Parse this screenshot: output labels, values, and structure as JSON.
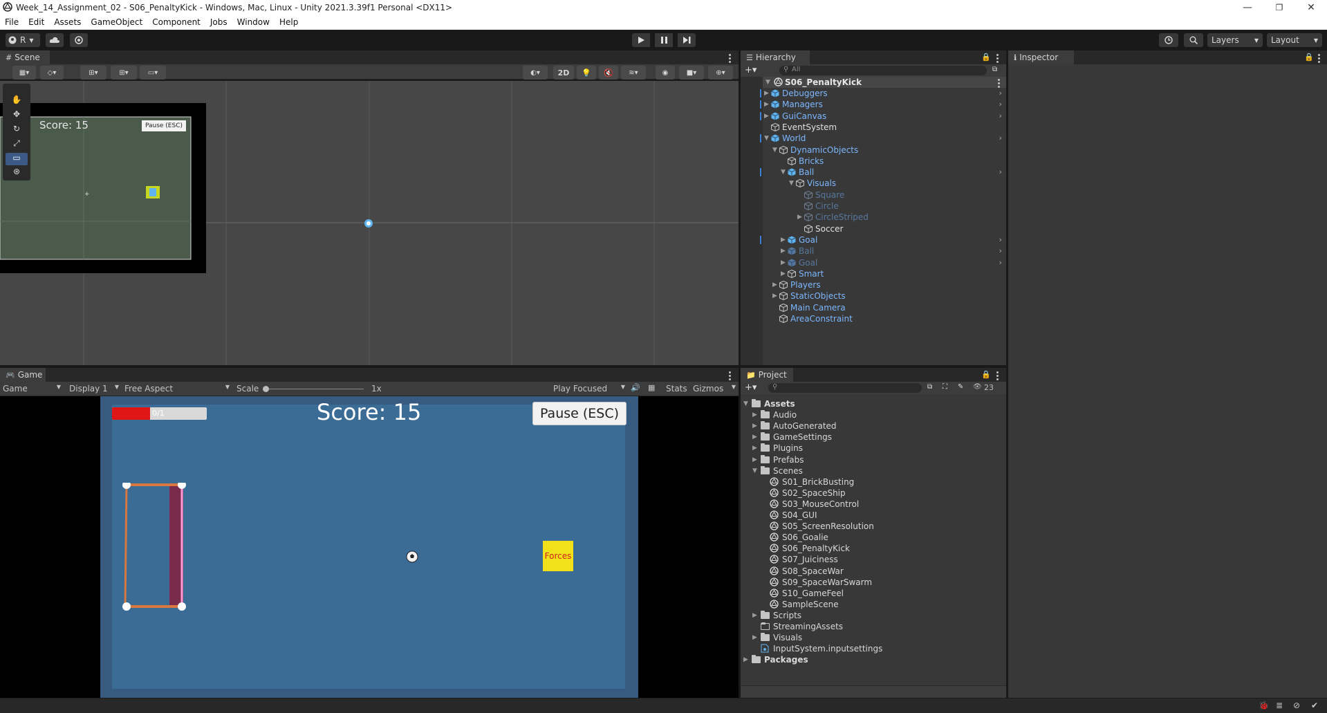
{
  "window": {
    "title": "Week_14_Assignment_02 - S06_PenaltyKick - Windows, Mac, Linux - Unity 2021.3.39f1 Personal <DX11>",
    "controls": [
      "—",
      "❐",
      "✕"
    ]
  },
  "menu": [
    "File",
    "Edit",
    "Assets",
    "GameObject",
    "Component",
    "Jobs",
    "Window",
    "Help"
  ],
  "toolbar": {
    "account_label": "R",
    "layers_label": "Layers",
    "layout_label": "Layout"
  },
  "scene": {
    "tab_label": "Scene",
    "mode_2d": "2D",
    "overlay_score": "Score: 15",
    "overlay_pause": "Pause (ESC)"
  },
  "hierarchy": {
    "tab_label": "Hierarchy",
    "search_placeholder": "All",
    "scene_root": "S06_PenaltyKick",
    "items": [
      {
        "label": "Debuggers",
        "depth": 1,
        "arrow": "collapsed",
        "prefab": true,
        "chevron": true,
        "dim": false
      },
      {
        "label": "Managers",
        "depth": 1,
        "arrow": "collapsed",
        "prefab": true,
        "chevron": true,
        "dim": false
      },
      {
        "label": "GuiCanvas",
        "depth": 1,
        "arrow": "collapsed",
        "prefab": true,
        "chevron": true,
        "dim": false
      },
      {
        "label": "EventSystem",
        "depth": 1,
        "arrow": "none",
        "prefab": false,
        "chevron": false,
        "dim": false,
        "plain": true
      },
      {
        "label": "World",
        "depth": 1,
        "arrow": "expanded",
        "prefab": true,
        "chevron": true,
        "dim": false
      },
      {
        "label": "DynamicObjects",
        "depth": 2,
        "arrow": "expanded",
        "prefab": false,
        "chevron": false,
        "dim": false
      },
      {
        "label": "Bricks",
        "depth": 3,
        "arrow": "none",
        "prefab": false,
        "chevron": false,
        "dim": false
      },
      {
        "label": "Ball",
        "depth": 3,
        "arrow": "expanded",
        "prefab": true,
        "chevron": true,
        "dim": false
      },
      {
        "label": "Visuals",
        "depth": 4,
        "arrow": "expanded",
        "prefab": false,
        "chevron": false,
        "dim": false
      },
      {
        "label": "Square",
        "depth": 5,
        "arrow": "none",
        "prefab": false,
        "chevron": false,
        "dim": true
      },
      {
        "label": "Circle",
        "depth": 5,
        "arrow": "none",
        "prefab": false,
        "chevron": false,
        "dim": true
      },
      {
        "label": "CircleStriped",
        "depth": 5,
        "arrow": "collapsed",
        "prefab": false,
        "chevron": false,
        "dim": true
      },
      {
        "label": "Soccer",
        "depth": 5,
        "arrow": "none",
        "prefab": false,
        "chevron": false,
        "dim": false,
        "plain": true
      },
      {
        "label": "Goal",
        "depth": 3,
        "arrow": "collapsed",
        "prefab": true,
        "chevron": true,
        "dim": false
      },
      {
        "label": "Ball",
        "depth": 3,
        "arrow": "collapsed",
        "prefab": true,
        "chevron": true,
        "dim": true
      },
      {
        "label": "Goal",
        "depth": 3,
        "arrow": "collapsed",
        "prefab": true,
        "chevron": true,
        "dim": true
      },
      {
        "label": "Smart",
        "depth": 3,
        "arrow": "collapsed",
        "prefab": false,
        "chevron": false,
        "dim": false
      },
      {
        "label": "Players",
        "depth": 2,
        "arrow": "collapsed",
        "prefab": false,
        "chevron": false,
        "dim": false
      },
      {
        "label": "StaticObjects",
        "depth": 2,
        "arrow": "collapsed",
        "prefab": false,
        "chevron": false,
        "dim": false
      },
      {
        "label": "Main Camera",
        "depth": 2,
        "arrow": "none",
        "prefab": false,
        "chevron": false,
        "dim": false
      },
      {
        "label": "AreaConstraint",
        "depth": 2,
        "arrow": "none",
        "prefab": false,
        "chevron": false,
        "dim": false
      }
    ]
  },
  "inspector": {
    "tab_label": "Inspector"
  },
  "game": {
    "tab_label": "Game",
    "dropdown_game": "Game",
    "dropdown_display": "Display 1",
    "dropdown_aspect": "Free Aspect",
    "scale_label": "Scale",
    "scale_value": "1x",
    "play_focused": "Play Focused",
    "stats": "Stats",
    "gizmos": "Gizmos",
    "score": "Score: 15",
    "pause_button": "Pause (ESC)",
    "health_text": "0/1",
    "health_fraction": 0.4,
    "forces_label": "Forces"
  },
  "project": {
    "tab_label": "Project",
    "hidden_count": "23",
    "tree": [
      {
        "label": "Assets",
        "depth": 0,
        "arrow": "expanded",
        "type": "folder",
        "bold": true
      },
      {
        "label": "Audio",
        "depth": 1,
        "arrow": "collapsed",
        "type": "folder"
      },
      {
        "label": "AutoGenerated",
        "depth": 1,
        "arrow": "collapsed",
        "type": "folder"
      },
      {
        "label": "GameSettings",
        "depth": 1,
        "arrow": "collapsed",
        "type": "folder"
      },
      {
        "label": "Plugins",
        "depth": 1,
        "arrow": "collapsed",
        "type": "folder"
      },
      {
        "label": "Prefabs",
        "depth": 1,
        "arrow": "collapsed",
        "type": "folder"
      },
      {
        "label": "Scenes",
        "depth": 1,
        "arrow": "expanded",
        "type": "folder"
      },
      {
        "label": "S01_BrickBusting",
        "depth": 2,
        "arrow": "none",
        "type": "scene"
      },
      {
        "label": "S02_SpaceShip",
        "depth": 2,
        "arrow": "none",
        "type": "scene"
      },
      {
        "label": "S03_MouseControl",
        "depth": 2,
        "arrow": "none",
        "type": "scene"
      },
      {
        "label": "S04_GUI",
        "depth": 2,
        "arrow": "none",
        "type": "scene"
      },
      {
        "label": "S05_ScreenResolution",
        "depth": 2,
        "arrow": "none",
        "type": "scene"
      },
      {
        "label": "S06_Goalie",
        "depth": 2,
        "arrow": "none",
        "type": "scene"
      },
      {
        "label": "S06_PenaltyKick",
        "depth": 2,
        "arrow": "none",
        "type": "scene"
      },
      {
        "label": "S07_Juiciness",
        "depth": 2,
        "arrow": "none",
        "type": "scene"
      },
      {
        "label": "S08_SpaceWar",
        "depth": 2,
        "arrow": "none",
        "type": "scene"
      },
      {
        "label": "S09_SpaceWarSwarm",
        "depth": 2,
        "arrow": "none",
        "type": "scene"
      },
      {
        "label": "S10_GameFeel",
        "depth": 2,
        "arrow": "none",
        "type": "scene"
      },
      {
        "label": "SampleScene",
        "depth": 2,
        "arrow": "none",
        "type": "scene"
      },
      {
        "label": "Scripts",
        "depth": 1,
        "arrow": "collapsed",
        "type": "folder"
      },
      {
        "label": "StreamingAssets",
        "depth": 1,
        "arrow": "none",
        "type": "folder-empty"
      },
      {
        "label": "Visuals",
        "depth": 1,
        "arrow": "collapsed",
        "type": "folder"
      },
      {
        "label": "InputSystem.inputsettings",
        "depth": 1,
        "arrow": "none",
        "type": "asset"
      },
      {
        "label": "Packages",
        "depth": 0,
        "arrow": "collapsed",
        "type": "folder",
        "bold": true
      }
    ]
  },
  "colors": {
    "prefab_blue": "#7cb7ff",
    "prefab_dim": "#58779e",
    "cube_blue": "#5fb4f0",
    "game_bg": "#365a80",
    "game_inner": "#3a6c96",
    "health_red": "#e01515",
    "goal_orange": "#d97740",
    "forces_yellow": "#f2e01a",
    "forces_text": "#d0241a"
  }
}
